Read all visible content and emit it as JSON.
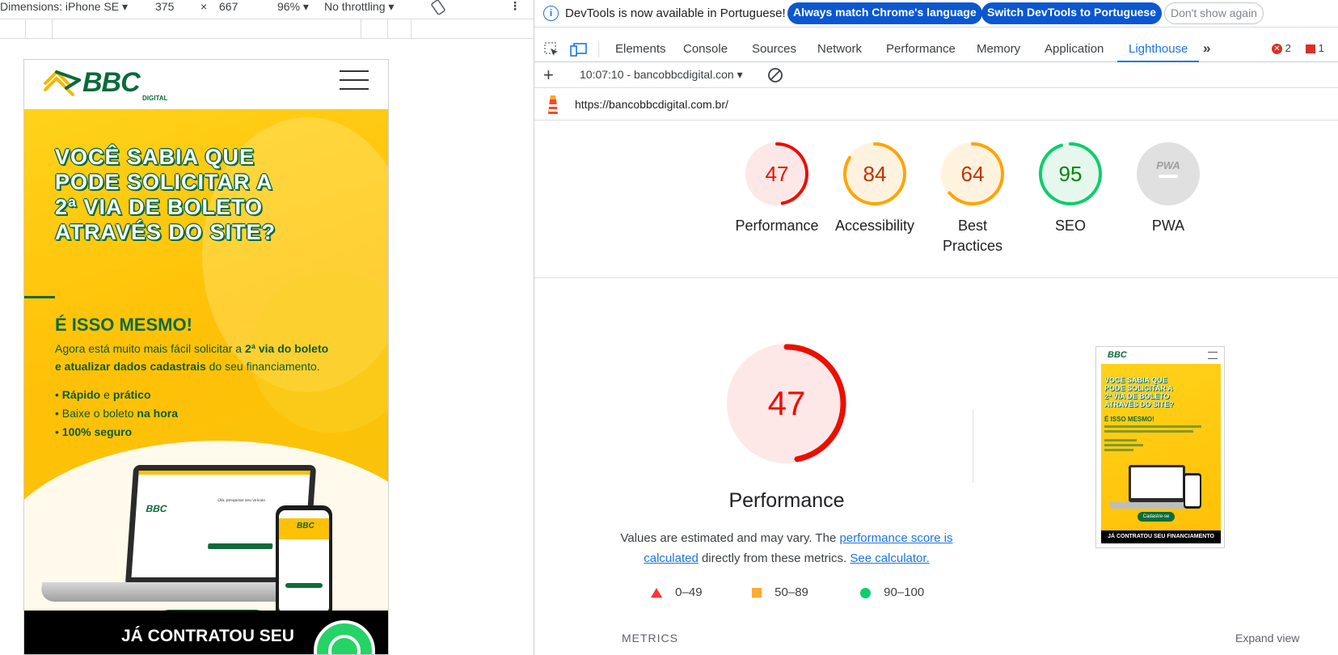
{
  "device_toolbar": {
    "dimensions_label": "Dimensions: iPhone SE",
    "width": "375",
    "times": "×",
    "height": "667",
    "zoom": "96%",
    "throttling": "No throttling"
  },
  "site": {
    "logo_text": "BBC",
    "logo_sub": "DIGITAL",
    "headline": [
      "VOCÊ SABIA QUE",
      "PODE SOLICITAR A",
      "2ª VIA DE BOLETO",
      "ATRAVÉS DO SITE?"
    ],
    "subheadline": "É ISSO MESMO!",
    "desc1_pre": "Agora está muito mais fácil solicitar a ",
    "desc1_bold": "2ª via do boleto",
    "desc2_bold": "e atualizar dados cadastrais",
    "desc2_post": " do seu financiamento.",
    "bullets": [
      {
        "bold": "Rápido",
        "mid": " e ",
        "bold2": "prático",
        "rest": ""
      },
      {
        "bold": "",
        "mid": "Baixe o boleto ",
        "bold2": "na hora",
        "rest": ""
      },
      {
        "bold": "100% seguro",
        "mid": "",
        "bold2": "",
        "rest": ""
      }
    ],
    "bullet_char": "•",
    "laptop_text": "Olá, pesquisar seu veículo",
    "cta": "Cadastre-se",
    "bottom_band": "JÁ CONTRATOU SEU"
  },
  "infobar": {
    "message": "DevTools is now available in Portuguese!",
    "btn_match": "Always match Chrome's language",
    "btn_switch": "Switch DevTools to Portuguese",
    "btn_dismiss": "Don't show again"
  },
  "tabs": [
    "Elements",
    "Console",
    "Sources",
    "Network",
    "Performance",
    "Memory",
    "Application",
    "Lighthouse"
  ],
  "active_tab": "Lighthouse",
  "errors_count": "2",
  "issues_count": "1",
  "lighthouse": {
    "report_select": "10:07:10 - bancobbcdigital.con",
    "url": "https://bancobbcdigital.com.br/",
    "categories": [
      {
        "label": "Performance",
        "score": "47",
        "value": 47,
        "color": "#eb0f00",
        "bg": "#fde8e7"
      },
      {
        "label": "Accessibility",
        "score": "84",
        "value": 84,
        "color": "#ffa400",
        "bg": "#fff3e0"
      },
      {
        "label": "Best Practices",
        "score": "64",
        "value": 64,
        "color": "#ffa400",
        "bg": "#fff3e0"
      },
      {
        "label": "SEO",
        "score": "95",
        "value": 95,
        "color": "#0cce6b",
        "bg": "#e6f8ee"
      },
      {
        "label": "PWA",
        "score": "",
        "value": 0,
        "color": "#bdbdbd",
        "bg": "#e0e0e0"
      }
    ],
    "pwa_badge": "PWA",
    "big_score": "47",
    "big_title": "Performance",
    "note_pre": "Values are estimated and may vary. The ",
    "note_link1": "performance score is calculated",
    "note_mid": " directly from these metrics. ",
    "note_link2": "See calculator.",
    "legend": [
      {
        "range": "0–49",
        "color": "#ff3333",
        "shape": "triangle"
      },
      {
        "range": "50–89",
        "color": "#ffaa33",
        "shape": "square"
      },
      {
        "range": "90–100",
        "color": "#0cce6b",
        "shape": "circle"
      }
    ],
    "thumb_band": "JÁ CONTRATOU SEU FINANCIAMENTO",
    "metrics_label": "METRICS",
    "expand_label": "Expand view"
  }
}
